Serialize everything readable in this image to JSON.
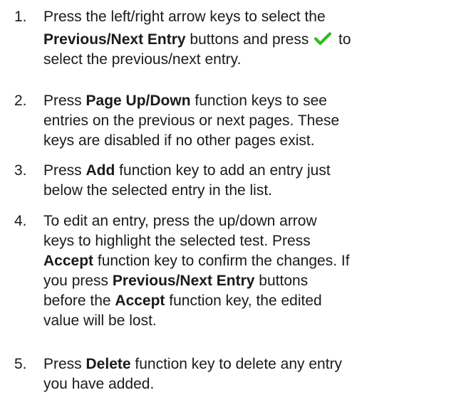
{
  "steps": [
    {
      "number": "1.",
      "line1": "Press the left/right arrow keys to select the",
      "line2_bold": "Previous/Next Entry",
      "line2_text": " buttons and press ",
      "line2_after": " to",
      "line3": "select the previous/next entry."
    },
    {
      "number": "2.",
      "line1_pre": "Press ",
      "line1_bold": "Page Up/Down",
      "line1_post": " function keys to see",
      "line2": "entries on the previous or next pages. These",
      "line3": "keys are disabled if no other pages exist."
    },
    {
      "number": "3.",
      "line1_pre": "Press ",
      "line1_bold": "Add",
      "line1_post": " function key to add an entry just",
      "line2": "below the selected entry in the list."
    },
    {
      "number": "4.",
      "line1": "To edit an entry, press the up/down arrow",
      "line2": "keys to highlight the selected test. Press",
      "line3_bold": "Accept",
      "line3_post": " function key to confirm the changes. If",
      "line4_pre": "you press ",
      "line4_bold": "Previous/Next Entry",
      "line4_post": " buttons",
      "line5_pre": "before the ",
      "line5_bold": "Accept",
      "line5_post": " function key, the edited",
      "line6": "value will be lost."
    },
    {
      "number": "5.",
      "line1_pre": "Press ",
      "line1_bold": "Delete",
      "line1_post": " function key to delete any entry",
      "line2": "you have added."
    }
  ],
  "icons": {
    "check": "checkmark-icon",
    "check_color": "#2fbf1f"
  }
}
